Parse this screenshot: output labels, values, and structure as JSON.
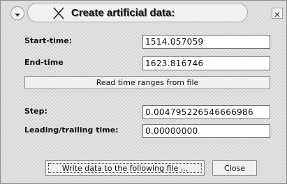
{
  "window": {
    "title": "Create artificial data:"
  },
  "fields": {
    "start_time": {
      "label": "Start-time:",
      "value": "1514.057059"
    },
    "end_time": {
      "label": "End-time",
      "value": "1623.816746"
    },
    "step": {
      "label": "Step:",
      "value": "0.004795226546666986"
    },
    "leading_trailing": {
      "label": "Leading/trailing time:",
      "value": "0.00000000"
    }
  },
  "buttons": {
    "read_time_ranges": "Read time ranges from file",
    "write_data": "Write data to the following file ...",
    "close": "Close"
  },
  "icons": {
    "window_menu": "chevron-down-icon",
    "title": "x-mark-icon",
    "close": "close-icon"
  }
}
